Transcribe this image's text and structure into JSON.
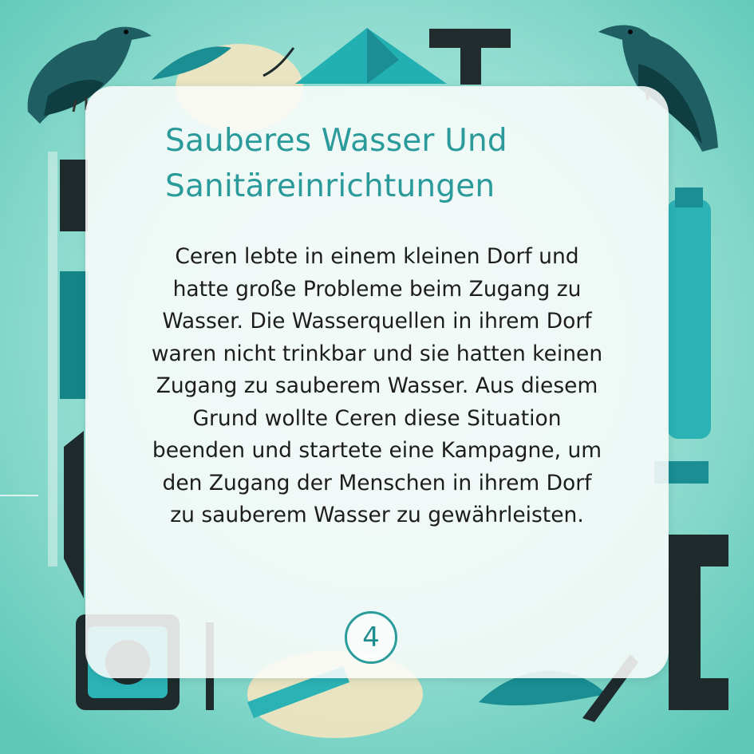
{
  "title_lines": [
    "Sauberes Wasser Und",
    "Sanitäreinrichtungen"
  ],
  "body_lines": [
    "Ceren lebte in einem kleinen Dorf und",
    "hatte große Probleme beim Zugang zu",
    "Wasser. Die Wasserquellen in ihrem Dorf",
    "waren nicht trinkbar und sie hatten keinen",
    "Zugang zu sauberem Wasser. Aus diesem",
    "Grund wollte Ceren diese Situation",
    "beenden und startete eine Kampagne, um",
    "den Zugang der Menschen in ihrem Dorf",
    "zu sauberem Wasser zu gewährleisten."
  ],
  "page_number": "4",
  "colors": {
    "background": "#7fd8cc",
    "accent": "#2a9a9b",
    "text": "#1d1d1d",
    "dark_shapes": "#1e2a2c",
    "card": "#fafcfa"
  },
  "decor_icons": [
    "crow-icon",
    "crow-icon",
    "paper-boat-icon",
    "letter-t-icon",
    "bottle-icon",
    "gear-icon",
    "pencil-icon",
    "letter-i-icon"
  ]
}
